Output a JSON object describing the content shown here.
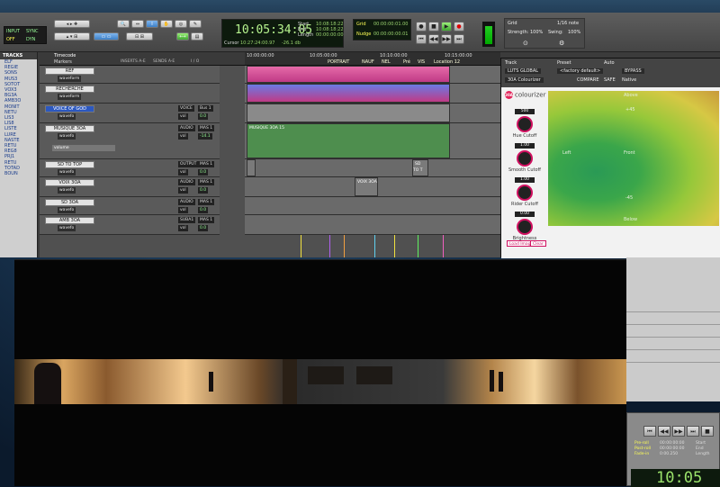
{
  "toolbar": {
    "modes": [
      "INPUT",
      "SYNC",
      "OFF",
      "DYN"
    ],
    "counter_main": "10:05:34:05",
    "counter_labels": [
      "Start",
      "End",
      "Length"
    ],
    "counter_values": [
      "10:08:18:22",
      "10:08:18:22",
      "00:00:00:00"
    ],
    "cursor_label": "Cursor",
    "cursor_value": "10:27:24:00.97",
    "db_value": "-26.1 db",
    "grid_label": "Grid",
    "grid_value": "00:00:00:01.00",
    "nudge_label": "Nudge",
    "nudge_value": "00:00:00:00.01",
    "midi_grid": "Grid",
    "midi_note": "1/16 note",
    "strength_label": "Strength:",
    "strength_value": "100%",
    "swing_label": "Swing:",
    "swing_value": "100%"
  },
  "tracks_panel": {
    "title": "TRACKS",
    "items": [
      "ELF",
      "REGIE",
      "SONS",
      "MUS3",
      "SOTOT",
      "VOX3",
      "BG3A",
      "AMB3O",
      "MONIT",
      "NETU",
      "LIS3",
      "LIS8",
      "LISTE",
      "LURE",
      "NASTE",
      "RETU",
      "REG8",
      "PRJ1",
      "RETU",
      "TOTAD",
      "BOUN"
    ]
  },
  "edit": {
    "timecode_label": "Timecode",
    "markers_label": "Markers",
    "ruler_times": [
      "10:00:00:00",
      "10:05:00:00",
      "10:10:00:00",
      "10:15:00:00"
    ],
    "ruler_markers": [
      "PORTRAIT",
      "NAUF",
      "NEL",
      "Pré",
      "VIS",
      "Location 12"
    ],
    "col_headers": [
      "INSERTS A-E",
      "SENDS A-E",
      "I / O"
    ],
    "tracks": [
      {
        "name": "REF",
        "mode": "waveform"
      },
      {
        "name": "RECHERCHE",
        "mode": "waveform"
      },
      {
        "name": "VOICE OF GOD",
        "mode": "wavefo",
        "io1": "VOICE",
        "io2": "Bus 1",
        "vol": "vol",
        "vol_value": "0.0"
      },
      {
        "name": "MUSIQUE 3OA",
        "mode": "wavefo",
        "io1": "AUDIO",
        "io2": "MAS 1",
        "vol": "vol",
        "vol_value": "-14.1",
        "sub": "volume"
      },
      {
        "name": "SD TO TOP",
        "mode": "wavefo",
        "io1": "OUTPUT",
        "io2": "MAS 1",
        "vol": "vol",
        "vol_value": "0.0"
      },
      {
        "name": "VOIX 3OA",
        "mode": "wavefo",
        "io1": "AUDIO",
        "io2": "MAS 1",
        "vol": "vol",
        "vol_value": "0.0"
      },
      {
        "name": "SD 3OA",
        "mode": "wavefo",
        "io1": "AUDIO",
        "io2": "MAS 1",
        "vol": "vol",
        "vol_value": "0.0"
      },
      {
        "name": "AMB 3OA",
        "mode": "wavefo",
        "io1": "SUBA1",
        "io2": "MAS 1",
        "vol": "vol",
        "vol_value": "0.0"
      }
    ],
    "clips": [
      "MUSIQUE 3OA 15",
      "SD TO T",
      "VOIX 3OA"
    ]
  },
  "plugin": {
    "track_label": "Track",
    "preset_label": "Preset",
    "auto_label": "Auto",
    "track_value": "LUTS GLOBAL",
    "preset_value": "<factory default>",
    "insert_value": "30A Colourizer",
    "compare": "COMPARE",
    "bypass": "BYPASS",
    "safe": "SAFE",
    "native": "Native",
    "logo_badge": "30A",
    "logo_text": "colourizer",
    "knobs": [
      {
        "label": "Hue Cutoff",
        "value": "500"
      },
      {
        "label": "Smooth Cutoff",
        "value": "1.00"
      },
      {
        "label": "Rider Cutoff",
        "value": "1.00"
      },
      {
        "label": "Brightness",
        "value": "0.00"
      }
    ],
    "field_labels": [
      "Above",
      "+45",
      "Left",
      "Front",
      "-45",
      "Below"
    ],
    "load_image": "Load Image",
    "clear": "Clear"
  },
  "transport_win": {
    "pre_roll": "Pre-roll",
    "post_roll": "Post-roll",
    "fade_in": "Fade-in",
    "start": "Start",
    "end": "End",
    "length": "Length",
    "pre_val": "00:00:00:00",
    "post_val": "00:00:00:00",
    "fade_val": "0:00.250",
    "big_counter": "10:05"
  },
  "colors": {
    "accent": "#d01060",
    "counter_green": "#b6f38e",
    "track_selected": "#2c58c0"
  }
}
